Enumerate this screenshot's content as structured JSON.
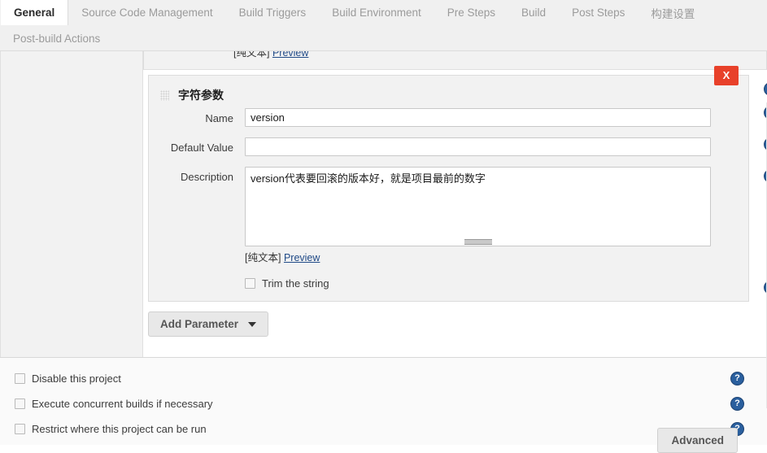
{
  "tabs": {
    "row1": [
      {
        "label": "General",
        "active": true
      },
      {
        "label": "Source Code Management",
        "active": false
      },
      {
        "label": "Build Triggers",
        "active": false
      },
      {
        "label": "Build Environment",
        "active": false
      },
      {
        "label": "Pre Steps",
        "active": false
      },
      {
        "label": "Build",
        "active": false
      },
      {
        "label": "Post Steps",
        "active": false
      },
      {
        "label": "构建设置",
        "active": false
      }
    ],
    "row2": [
      {
        "label": "Post-build Actions",
        "active": false
      }
    ]
  },
  "previous_block": {
    "plain_text_label": "[纯文本]",
    "preview_label": "Preview"
  },
  "parameter": {
    "title": "字符参数",
    "delete_label": "X",
    "fields": {
      "name_label": "Name",
      "name_value": "version",
      "default_label": "Default Value",
      "default_value": "",
      "description_label": "Description",
      "description_value": "version代表要回滚的版本好，就是项目最前的数字"
    },
    "plain_text_label": "[纯文本]",
    "preview_label": "Preview",
    "trim_label": "Trim the string",
    "trim_checked": false
  },
  "add_parameter": {
    "label": "Add Parameter"
  },
  "options": [
    {
      "label": "Disable this project",
      "checked": false
    },
    {
      "label": "Execute concurrent builds if necessary",
      "checked": false
    },
    {
      "label": "Restrict where this project can be run",
      "checked": false
    }
  ],
  "advanced": {
    "label": "Advanced"
  },
  "colors": {
    "delete_red": "#e8412a",
    "help_blue": "#2a5f9e",
    "link_blue": "#204a87",
    "panel_bg": "#f2f2f2"
  }
}
